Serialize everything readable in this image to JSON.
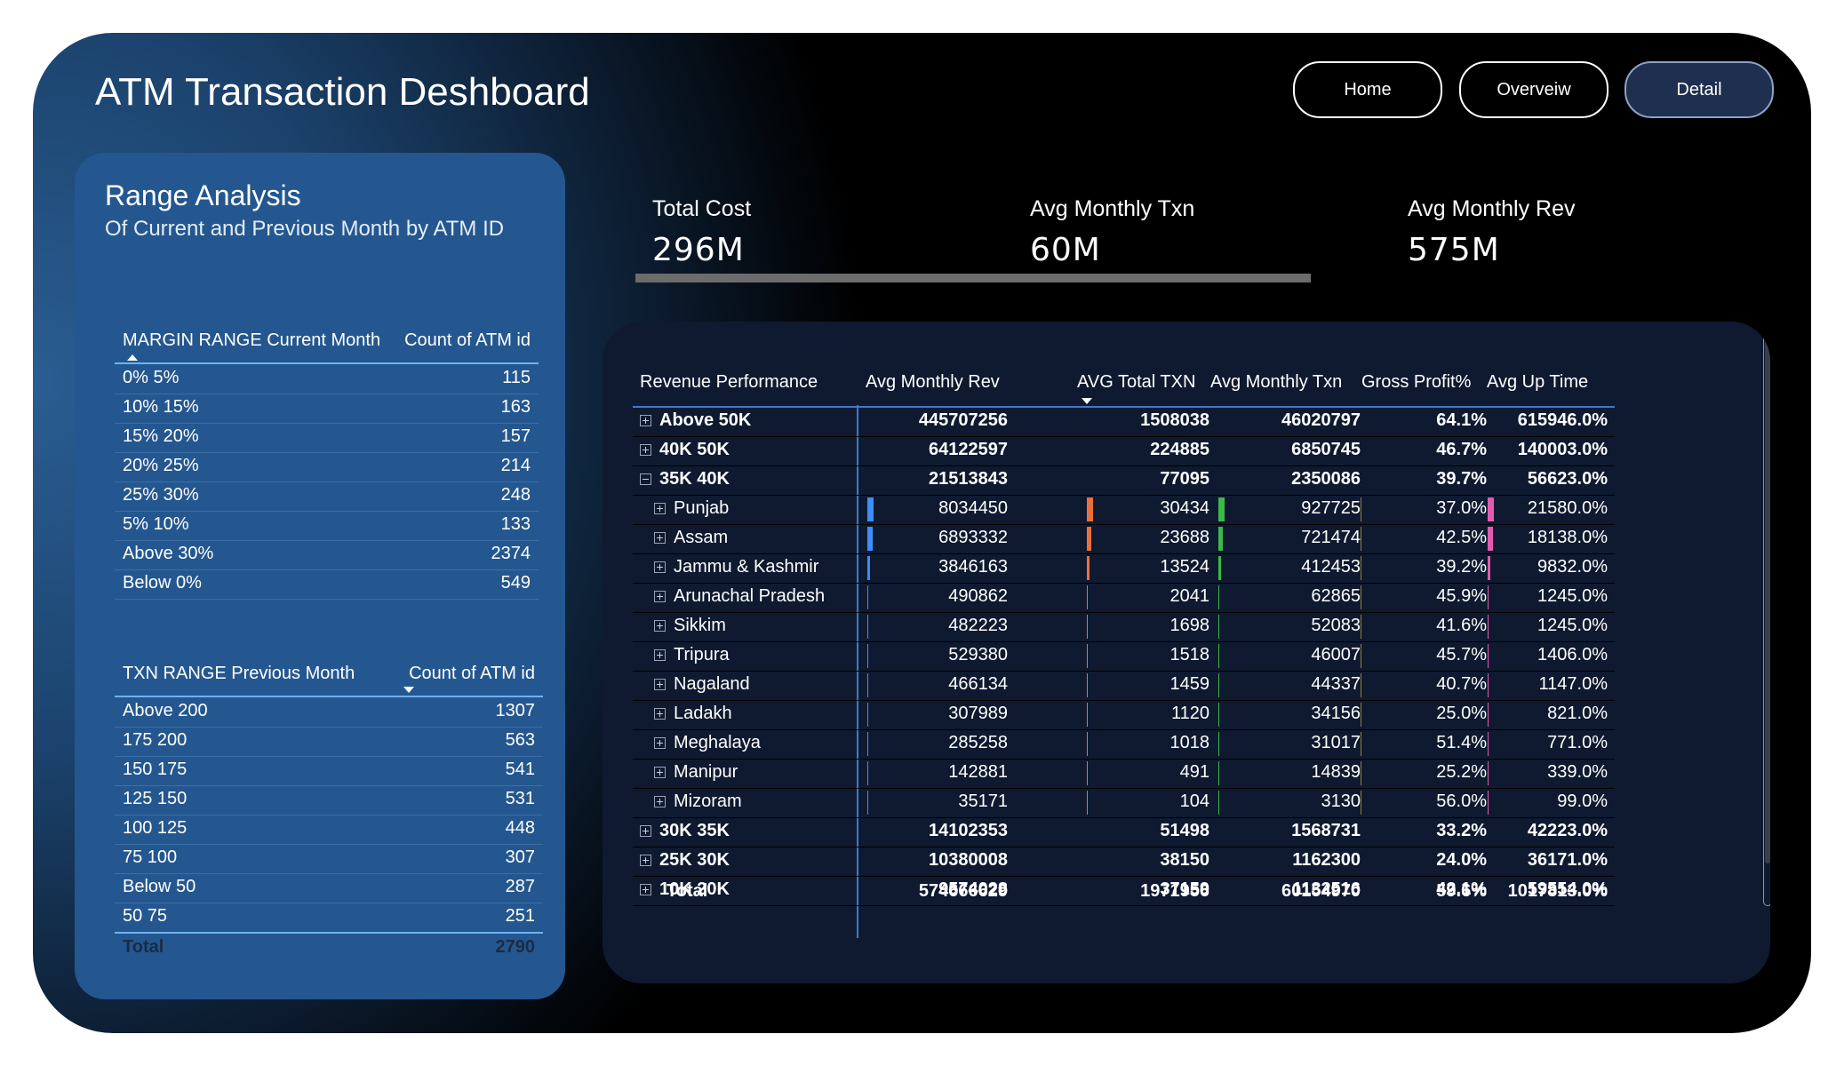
{
  "title": "ATM Transaction Deshboard",
  "nav": {
    "home": "Home",
    "overview": "Overveiw",
    "detail": "Detail"
  },
  "range_panel": {
    "title": "Range Analysis",
    "subtitle": "Of Current and Previous Month by ATM ID",
    "margin_table": {
      "col1": "MARGIN RANGE Current Month",
      "col2": "Count of ATM id",
      "rows": [
        {
          "label": "0% 5%",
          "count": "115"
        },
        {
          "label": "10% 15%",
          "count": "163"
        },
        {
          "label": "15% 20%",
          "count": "157"
        },
        {
          "label": "20% 25%",
          "count": "214"
        },
        {
          "label": "25% 30%",
          "count": "248"
        },
        {
          "label": "5% 10%",
          "count": "133"
        },
        {
          "label": "Above 30%",
          "count": "2374"
        },
        {
          "label": "Below 0%",
          "count": "549"
        }
      ]
    },
    "txn_table": {
      "col1": "TXN RANGE Previous Month",
      "col2": "Count of ATM id",
      "rows": [
        {
          "label": "Above 200",
          "count": "1307"
        },
        {
          "label": "175 200",
          "count": "563"
        },
        {
          "label": "150 175",
          "count": "541"
        },
        {
          "label": "125 150",
          "count": "531"
        },
        {
          "label": "100 125",
          "count": "448"
        },
        {
          "label": "75 100",
          "count": "307"
        },
        {
          "label": "Below 50",
          "count": "287"
        },
        {
          "label": "50 75",
          "count": "251"
        }
      ],
      "total_label": "Total",
      "total_value": "2790"
    }
  },
  "kpis": [
    {
      "label": "Total Cost",
      "value": "296M"
    },
    {
      "label": "Avg Monthly Txn",
      "value": "60M"
    },
    {
      "label": "Avg Monthly Rev",
      "value": "575M"
    }
  ],
  "matrix": {
    "headers": [
      "Revenue Performance",
      "Avg Monthly Rev",
      "AVG Total TXN",
      "Avg Monthly Txn",
      "Gross Profit%",
      "Avg Up Time"
    ],
    "bar_colors": {
      "rev": "#3b8fff",
      "txn": "#e8703a",
      "mtxn": "#3cb84a",
      "gp": "#c8b03a",
      "up": "#e05cb0"
    },
    "rows": [
      {
        "name": "Above 50K",
        "rev": "445707256",
        "txn": "1508038",
        "mtxn": "46020797",
        "gp": "64.1%",
        "up": "615946.0%",
        "level": 0,
        "expanded": false
      },
      {
        "name": "40K 50K",
        "rev": "64122597",
        "txn": "224885",
        "mtxn": "6850745",
        "gp": "46.7%",
        "up": "140003.0%",
        "level": 0,
        "expanded": false
      },
      {
        "name": "35K 40K",
        "rev": "21513843",
        "txn": "77095",
        "mtxn": "2350086",
        "gp": "39.7%",
        "up": "56623.0%",
        "level": 0,
        "expanded": true
      },
      {
        "name": "Punjab",
        "rev": "8034450",
        "txn": "30434",
        "mtxn": "927725",
        "gp": "37.0%",
        "up": "21580.0%",
        "level": 1,
        "bar_rev": 1.0,
        "bar_txn": 1.0,
        "bar_mtxn": 1.0,
        "bar_up": 1.0
      },
      {
        "name": "Assam",
        "rev": "6893332",
        "txn": "23688",
        "mtxn": "721474",
        "gp": "42.5%",
        "up": "18138.0%",
        "level": 1,
        "bar_rev": 0.86,
        "bar_txn": 0.78,
        "bar_mtxn": 0.78,
        "bar_up": 0.84
      },
      {
        "name": "Jammu & Kashmir",
        "rev": "3846163",
        "txn": "13524",
        "mtxn": "412453",
        "gp": "39.2%",
        "up": "9832.0%",
        "level": 1,
        "bar_rev": 0.48,
        "bar_txn": 0.44,
        "bar_mtxn": 0.44,
        "bar_up": 0.46
      },
      {
        "name": "Arunachal Pradesh",
        "rev": "490862",
        "txn": "2041",
        "mtxn": "62865",
        "gp": "45.9%",
        "up": "1245.0%",
        "level": 1,
        "bar_rev": 0.06,
        "bar_txn": 0.07,
        "bar_mtxn": 0.07,
        "bar_up": 0.06
      },
      {
        "name": "Sikkim",
        "rev": "482223",
        "txn": "1698",
        "mtxn": "52083",
        "gp": "41.6%",
        "up": "1245.0%",
        "level": 1,
        "bar_rev": 0.06,
        "bar_txn": 0.06,
        "bar_mtxn": 0.06,
        "bar_up": 0.06
      },
      {
        "name": "Tripura",
        "rev": "529380",
        "txn": "1518",
        "mtxn": "46007",
        "gp": "45.7%",
        "up": "1406.0%",
        "level": 1,
        "bar_rev": 0.07,
        "bar_txn": 0.05,
        "bar_mtxn": 0.05,
        "bar_up": 0.07
      },
      {
        "name": "Nagaland",
        "rev": "466134",
        "txn": "1459",
        "mtxn": "44337",
        "gp": "40.7%",
        "up": "1147.0%",
        "level": 1,
        "bar_rev": 0.06,
        "bar_txn": 0.05,
        "bar_mtxn": 0.05,
        "bar_up": 0.05
      },
      {
        "name": "Ladakh",
        "rev": "307989",
        "txn": "1120",
        "mtxn": "34156",
        "gp": "25.0%",
        "up": "821.0%",
        "level": 1,
        "bar_rev": 0.04,
        "bar_txn": 0.04,
        "bar_mtxn": 0.04,
        "bar_up": 0.04
      },
      {
        "name": "Meghalaya",
        "rev": "285258",
        "txn": "1018",
        "mtxn": "31017",
        "gp": "51.4%",
        "up": "771.0%",
        "level": 1,
        "bar_rev": 0.04,
        "bar_txn": 0.03,
        "bar_mtxn": 0.03,
        "bar_up": 0.04
      },
      {
        "name": "Manipur",
        "rev": "142881",
        "txn": "491",
        "mtxn": "14839",
        "gp": "25.2%",
        "up": "339.0%",
        "level": 1,
        "bar_rev": 0.02,
        "bar_txn": 0.02,
        "bar_mtxn": 0.02,
        "bar_up": 0.02
      },
      {
        "name": "Mizoram",
        "rev": "35171",
        "txn": "104",
        "mtxn": "3130",
        "gp": "56.0%",
        "up": "99.0%",
        "level": 1,
        "bar_rev": 0.0,
        "bar_txn": 0.0,
        "bar_mtxn": 0.0,
        "bar_up": 0.0
      },
      {
        "name": "30K 35K",
        "rev": "14102353",
        "txn": "51498",
        "mtxn": "1568731",
        "gp": "33.2%",
        "up": "42223.0%",
        "level": 0,
        "expanded": false
      },
      {
        "name": "25K 30K",
        "rev": "10380008",
        "txn": "38150",
        "mtxn": "1162300",
        "gp": "24.0%",
        "up": "36171.0%",
        "level": 0,
        "expanded": false
      },
      {
        "name": "10K 20K",
        "rev": "9574028",
        "txn": "37159",
        "mtxn": "1132516",
        "gp": "42.1%",
        "up": "59554.0%",
        "level": 0,
        "expanded": false
      }
    ],
    "total": {
      "name": "Total",
      "rev": "574666629",
      "txn": "1971956",
      "mtxn": "60154970",
      "gp": "59.6%",
      "up": "1017813.0%"
    }
  }
}
